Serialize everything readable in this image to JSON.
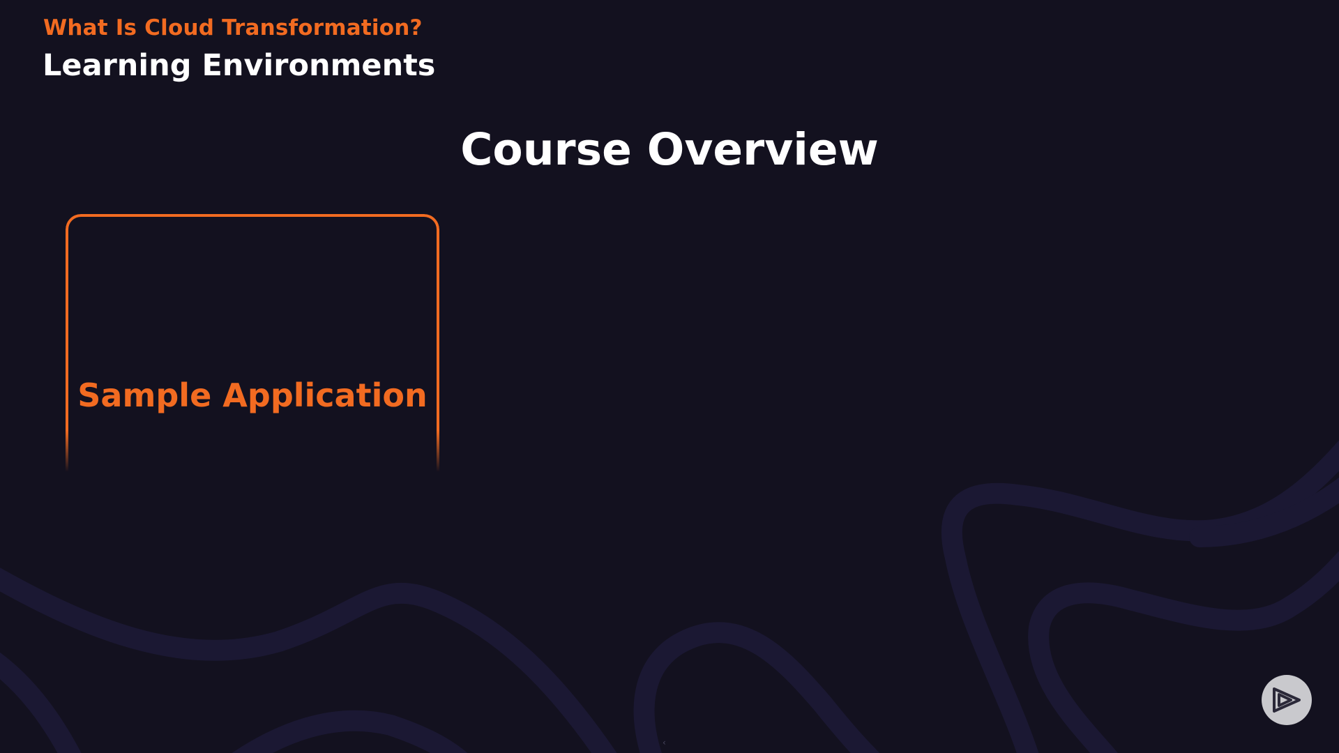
{
  "header": {
    "module_title": "What Is Cloud Transformation?",
    "clip_title": "Learning Environments"
  },
  "slide": {
    "heading": "Course Overview",
    "card_label": "Sample Application"
  },
  "icons": {
    "player_logo": "play-logo-icon",
    "background": "wave-lines"
  },
  "colors": {
    "background": "#13111f",
    "accent": "#f26b21",
    "heading": "#ffffff",
    "wave": "#1d1a36",
    "logo_bg": "#c9c9cd",
    "logo_fg": "#2a2838"
  }
}
